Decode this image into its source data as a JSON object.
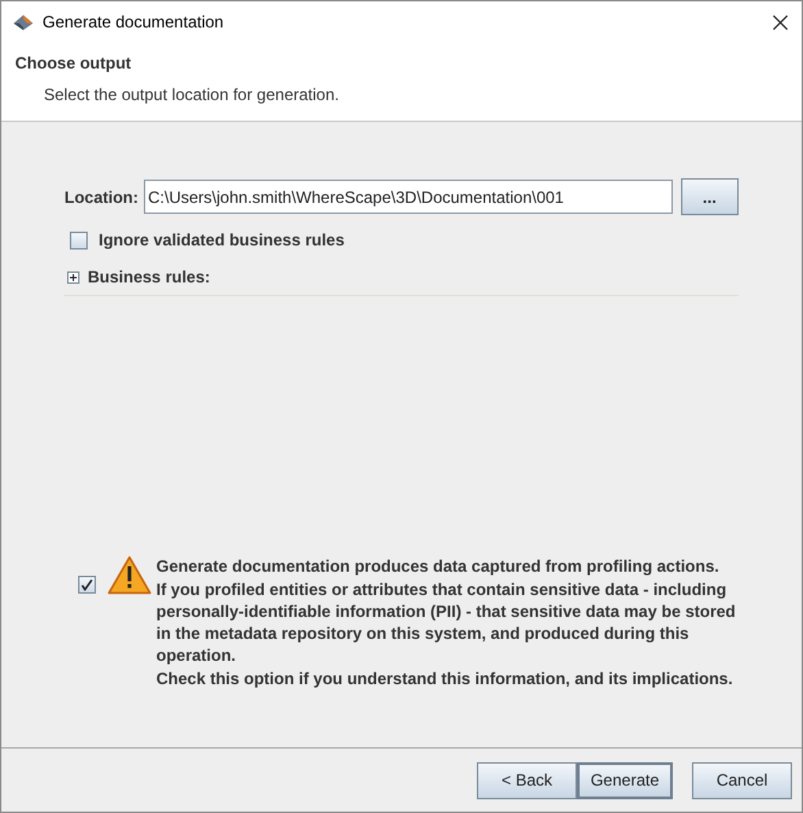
{
  "window": {
    "title": "Generate documentation"
  },
  "header": {
    "title": "Choose output",
    "subtitle": "Select the output location for generation."
  },
  "location": {
    "label": "Location:",
    "value": "C:\\Users\\john.smith\\WhereScape\\3D\\Documentation\\001",
    "browse_button": "..."
  },
  "ignore_validated": {
    "label": "Ignore validated business rules",
    "checked": false
  },
  "business_rules": {
    "label": "Business rules:",
    "expanded": false
  },
  "acknowledge": {
    "checked": true,
    "message": "Generate documentation produces data captured from profiling actions.\nIf you profiled entities or attributes that contain sensitive data - including\npersonally-identifiable information (PII) - that sensitive data may be stored\nin the metadata repository on this system, and produced during this\noperation.\nCheck this option if you understand this information, and its implications."
  },
  "buttons": [
    {
      "label": "< Back",
      "default": false
    },
    {
      "label": "Generate",
      "default": true
    },
    {
      "label": "Cancel",
      "default": false
    }
  ]
}
